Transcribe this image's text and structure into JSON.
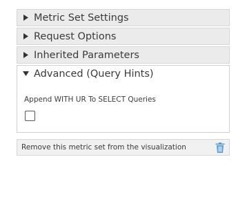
{
  "sections": [
    {
      "label": "Metric Set Settings",
      "expanded": false
    },
    {
      "label": "Request Options",
      "expanded": false
    },
    {
      "label": "Inherited Parameters",
      "expanded": false
    },
    {
      "label": "Advanced (Query Hints)",
      "expanded": true
    }
  ],
  "advanced": {
    "option_label": "Append WITH UR To SELECT Queries",
    "checked": false
  },
  "remove": {
    "label": "Remove this metric set from the visualization",
    "icon": "trash-icon"
  },
  "colors": {
    "header_bg": "#ebebeb",
    "trash_blue": "#5b9bd5"
  }
}
